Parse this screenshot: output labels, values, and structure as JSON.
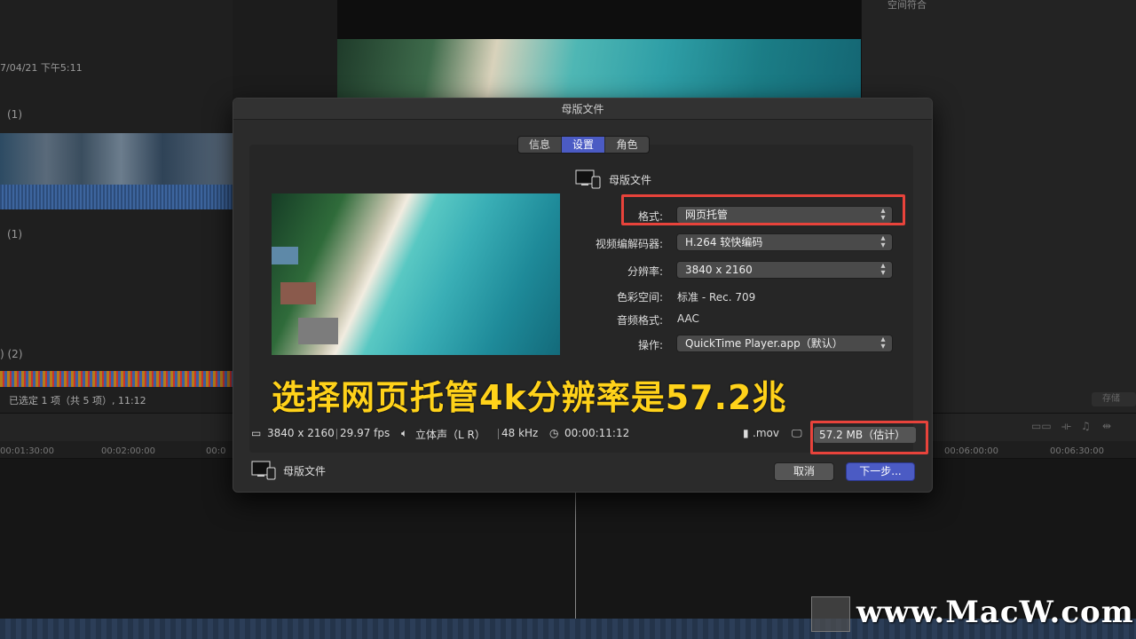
{
  "background": {
    "right_panel_label": "空间符合",
    "left_date": "7/04/21 下午5:11",
    "left_counts": [
      "(1)",
      "(1)",
      ") (2)"
    ],
    "left_status": "已选定 1 项（共 5 项）, 11:12",
    "save_button": "存储",
    "ruler_ticks": [
      "00:01:30:00",
      "00:02:00:00",
      "00:0",
      "00:06:00:00",
      "00:06:30:00"
    ]
  },
  "dialog": {
    "title": "母版文件",
    "tabs": [
      {
        "label": "信息",
        "active": false
      },
      {
        "label": "设置",
        "active": true
      },
      {
        "label": "角色",
        "active": false
      }
    ],
    "section_label": "母版文件",
    "settings": {
      "format": {
        "label": "格式:",
        "value": "网页托管"
      },
      "video_codec": {
        "label": "视频编解码器:",
        "value": "H.264 较快编码"
      },
      "resolution": {
        "label": "分辨率:",
        "value": "3840 x 2160"
      },
      "color_space": {
        "label": "色彩空间:",
        "value": "标准 - Rec. 709"
      },
      "audio_format": {
        "label": "音频格式:",
        "value": "AAC"
      },
      "action": {
        "label": "操作:",
        "value": "QuickTime Player.app（默认）"
      }
    },
    "caption": "选择网页托管4k分辨率是57.2兆",
    "info_bar": {
      "resolution": "3840 x 2160",
      "fps": "29.97 fps",
      "audio": "立体声（L R）",
      "sample_rate": "48 kHz",
      "duration": "00:00:11:12",
      "extension": ".mov",
      "size_estimate": "57.2 MB（估计）"
    },
    "footer_label": "母版文件",
    "cancel_label": "取消",
    "next_label": "下一步..."
  },
  "watermark": "www.MacW.com",
  "colors": {
    "accent": "#4b5bc4",
    "highlight": "#e8433b",
    "caption": "#ffd21a"
  }
}
